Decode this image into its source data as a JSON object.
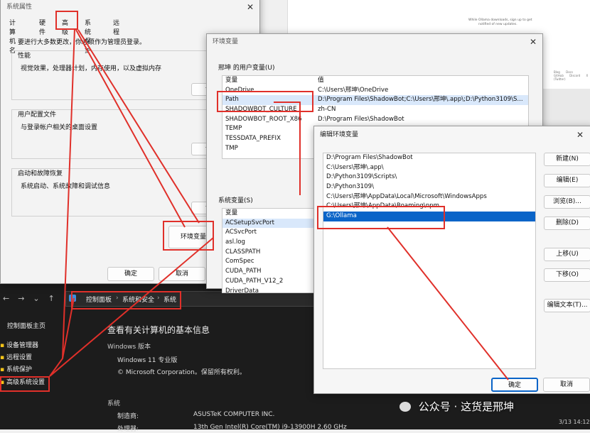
{
  "bg_doc": {
    "line1": "While Ollama downloads, sign up to get",
    "line2": "notified of new updates.",
    "nav": [
      "Blog",
      "Docs",
      "GitHub",
      "Discord",
      "X (Twitter)"
    ]
  },
  "sys_props": {
    "title": "系统属性",
    "tabs": [
      "计算机名",
      "硬件",
      "高级",
      "系统保护",
      "远程"
    ],
    "notice": "要进行大多数更改，你必须作为管理员登录。",
    "perf_title": "性能",
    "perf_desc": "视觉效果，处理器计划，内存使用，以及虚拟内存",
    "profile_title": "用户配置文件",
    "profile_desc": "与登录帐户相关的桌面设置",
    "startup_title": "启动和故障恢复",
    "startup_desc": "系统启动、系统故障和调试信息",
    "settings_btn": "设",
    "env_btn": "环境变量",
    "ok": "确定",
    "cancel": "取消"
  },
  "env_vars": {
    "title": "环境变量",
    "user_section": "邢坤 的用户变量(U)",
    "col_var": "变量",
    "col_val": "值",
    "user_vars": [
      {
        "name": "OneDrive",
        "value": "C:\\Users\\邢坤\\OneDrive"
      },
      {
        "name": "Path",
        "value": "D:\\Program Files\\ShadowBot;C:\\Users\\邢坤\\.app\\;D:\\Python3109\\S..."
      },
      {
        "name": "SHADOWBOT_CULTURE",
        "value": "zh-CN"
      },
      {
        "name": "SHADOWBOT_ROOT_X86",
        "value": "D:\\Program Files\\ShadowBot"
      },
      {
        "name": "TEMP",
        "value": ""
      },
      {
        "name": "TESSDATA_PREFIX",
        "value": ""
      },
      {
        "name": "TMP",
        "value": ""
      }
    ],
    "sys_section": "系统变量(S)",
    "sys_vars": [
      "ACSetupSvcPort",
      "ACSvcPort",
      "asl.log",
      "CLASSPATH",
      "ComSpec",
      "CUDA_PATH",
      "CUDA_PATH_V12_2",
      "DriverData"
    ]
  },
  "edit_env": {
    "title": "编辑环境变量",
    "entries": [
      "D:\\Program Files\\ShadowBot",
      "C:\\Users\\邢坤\\.app\\",
      "D:\\Python3109\\Scripts\\",
      "D:\\Python3109\\",
      "C:\\Users\\邢坤\\AppData\\Local\\Microsoft\\WindowsApps",
      "C:\\Users\\邢坤\\AppData\\Roaming\\npm",
      "G:\\Ollama"
    ],
    "selected_index": 6,
    "buttons": [
      "新建(N)",
      "编辑(E)",
      "浏览(B)...",
      "删除(D)",
      "上移(U)",
      "下移(O)",
      "编辑文本(T)..."
    ],
    "ok": "确定",
    "cancel": "取消"
  },
  "control_panel": {
    "breadcrumb": [
      "控制面板",
      "系统和安全",
      "系统"
    ],
    "home": "控制面板主页",
    "links": [
      "设备管理器",
      "远程设置",
      "系统保护",
      "高级系统设置"
    ],
    "heading": "查看有关计算机的基本信息",
    "win_section": "Windows 版本",
    "win_edition": "Windows 11 专业版",
    "copyright": "© Microsoft Corporation。保留所有权利。",
    "sys_section": "系统",
    "maker_label": "制造商:",
    "maker_value": "ASUSTeK COMPUTER INC.",
    "cpu_label": "处理器:",
    "cpu_value": "13th Gen Intel(R) Core(TM) i9-13900H   2.60 GHz"
  },
  "taskbar": {
    "time": "3/13 14:12"
  },
  "watermark": "公众号 · 这货是邢坤",
  "colors": {
    "accent": "#0a64c8",
    "annotation": "#e0302a"
  }
}
